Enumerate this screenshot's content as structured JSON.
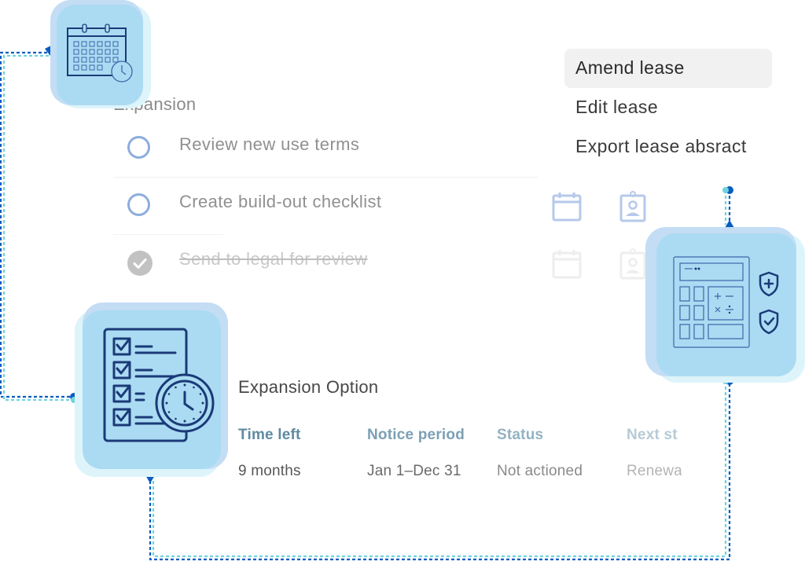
{
  "menu": {
    "items": [
      {
        "label": "Amend lease",
        "active": true
      },
      {
        "label": "Edit lease",
        "active": false
      },
      {
        "label": "Export lease absract",
        "active": false
      }
    ]
  },
  "section": {
    "title": "Expansion",
    "tasks": [
      {
        "label": "Review new use terms",
        "status": "open"
      },
      {
        "label": "Create build-out checklist",
        "status": "open",
        "icons": [
          "calendar-icon",
          "contact-badge-icon"
        ]
      },
      {
        "label": "Send to legal for review",
        "status": "done",
        "icons": [
          "calendar-icon",
          "contact-badge-icon"
        ]
      }
    ]
  },
  "option": {
    "title": "Expansion Option",
    "columns": [
      {
        "header": "Time left",
        "value": "9 months"
      },
      {
        "header": "Notice period",
        "value": "Jan 1–Dec 31"
      },
      {
        "header": "Status",
        "value": "Not actioned"
      },
      {
        "header": "Next st",
        "value": "Renewa"
      }
    ]
  },
  "tiles": {
    "calendar": "calendar-clock-icon",
    "checklist": "checklist-clock-icon",
    "calculator": "calculator-shield-icon"
  },
  "colors": {
    "tile_face": "#abdbf2",
    "tile_back": "#c3ddf5",
    "icon_navy": "#1a3a78",
    "connector_blue": "#0a5cc0",
    "connector_teal": "#6fd3dc",
    "unchecked_ring": "#8eaedb"
  }
}
